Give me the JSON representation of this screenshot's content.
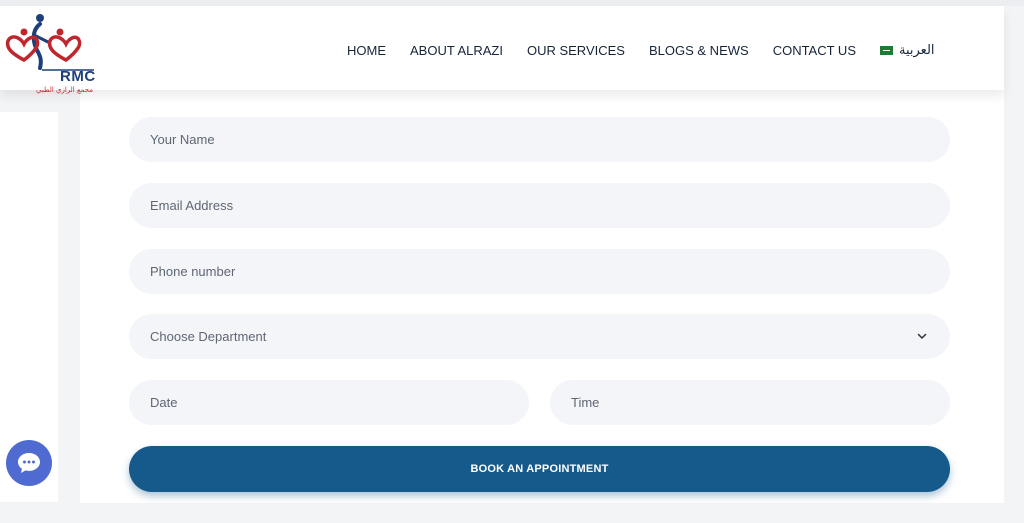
{
  "brand": {
    "name": "RMC",
    "subtitle": "مجمع الرازي الطبي"
  },
  "nav": {
    "items": [
      {
        "label": "HOME"
      },
      {
        "label": "ABOUT ALRAZI"
      },
      {
        "label": "OUR SERVICES"
      },
      {
        "label": "BLOGS & NEWS"
      },
      {
        "label": "CONTACT US"
      }
    ],
    "language_label": "العربية"
  },
  "form": {
    "name_placeholder": "Your Name",
    "email_placeholder": "Email Address",
    "phone_placeholder": "Phone number",
    "department_selected": "Choose Department",
    "date_placeholder": "Date",
    "time_placeholder": "Time",
    "submit_label": "BOOK AN APPOINTMENT"
  },
  "colors": {
    "primary": "#155a8a",
    "chat": "#4f6bd1",
    "logo_red": "#c0262d",
    "logo_blue": "#1d3f7a"
  },
  "icons": {
    "chevron": "chevron-down-icon",
    "chat": "chat-bubble-icon",
    "flag": "saudi-flag-icon"
  }
}
